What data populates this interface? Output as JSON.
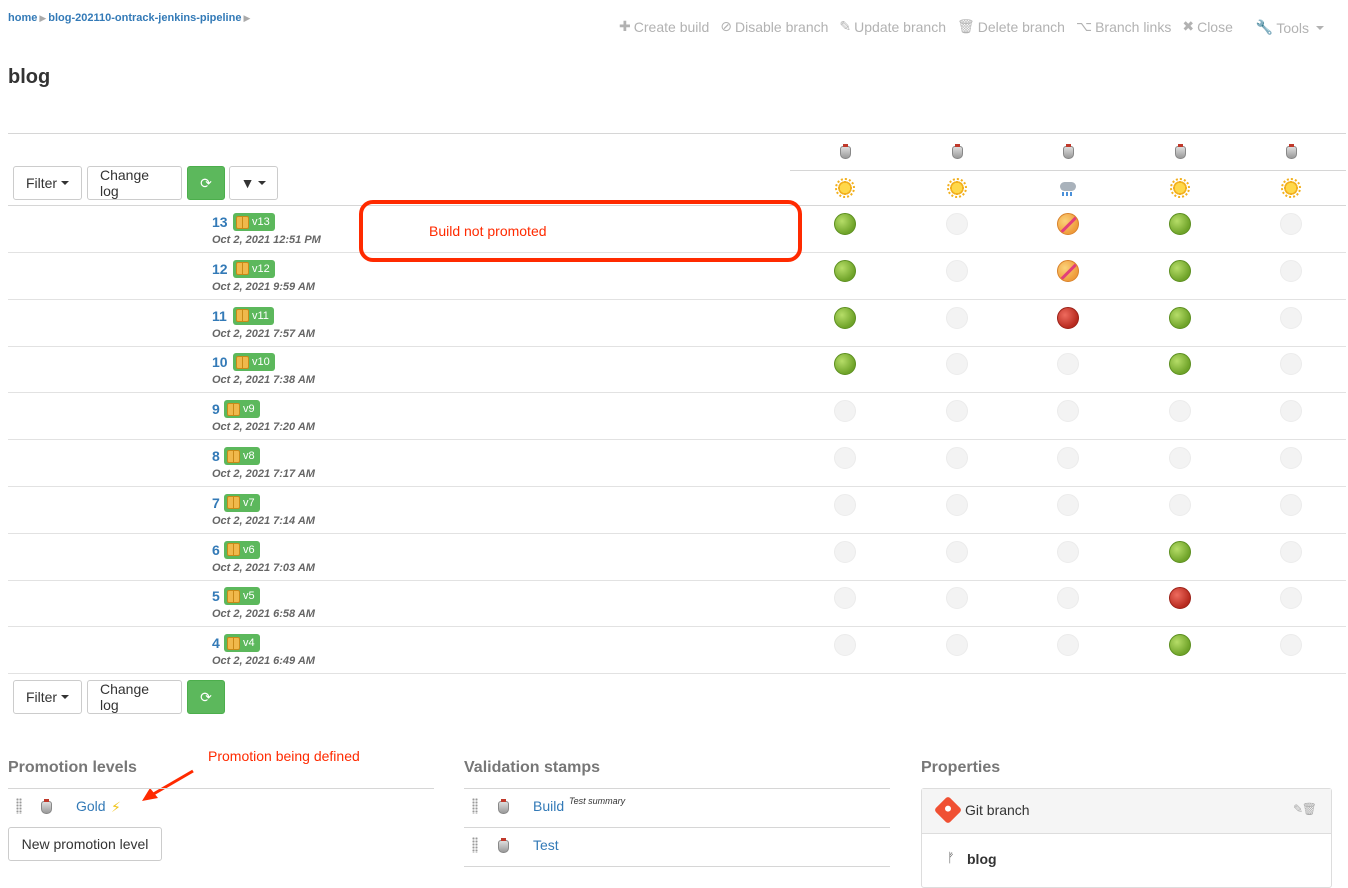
{
  "breadcrumb": {
    "home": "home",
    "project": "blog-202110-ontrack-jenkins-pipeline",
    "sep": "▶"
  },
  "toolbar": {
    "create_build": "Create build",
    "disable_branch": "Disable branch",
    "update_branch": "Update branch",
    "delete_branch": "Delete branch",
    "branch_links": "Branch links",
    "close": "Close",
    "tools": "Tools"
  },
  "page_title": "blog",
  "controls": {
    "filter": "Filter",
    "change_log": "Change log"
  },
  "column_weather": [
    "sun",
    "sun",
    "cloud-rain",
    "sun",
    "sun"
  ],
  "builds": [
    {
      "number": "13",
      "label": "v13",
      "date": "Oct 2, 2021 12:51 PM",
      "statuses": [
        "passed",
        "none",
        "defect",
        "passed",
        "none"
      ]
    },
    {
      "number": "12",
      "label": "v12",
      "date": "Oct 2, 2021 9:59 AM",
      "statuses": [
        "passed",
        "none",
        "defect",
        "passed",
        "none"
      ]
    },
    {
      "number": "11",
      "label": "v11",
      "date": "Oct 2, 2021 7:57 AM",
      "statuses": [
        "passed",
        "none",
        "failed",
        "passed",
        "none"
      ]
    },
    {
      "number": "10",
      "label": "v10",
      "date": "Oct 2, 2021 7:38 AM",
      "statuses": [
        "passed",
        "none",
        "none",
        "passed",
        "none"
      ]
    },
    {
      "number": "9",
      "label": "v9",
      "date": "Oct 2, 2021 7:20 AM",
      "statuses": [
        "none",
        "none",
        "none",
        "none",
        "none"
      ]
    },
    {
      "number": "8",
      "label": "v8",
      "date": "Oct 2, 2021 7:17 AM",
      "statuses": [
        "none",
        "none",
        "none",
        "none",
        "none"
      ]
    },
    {
      "number": "7",
      "label": "v7",
      "date": "Oct 2, 2021 7:14 AM",
      "statuses": [
        "none",
        "none",
        "none",
        "none",
        "none"
      ]
    },
    {
      "number": "6",
      "label": "v6",
      "date": "Oct 2, 2021 7:03 AM",
      "statuses": [
        "none",
        "none",
        "none",
        "passed",
        "none"
      ]
    },
    {
      "number": "5",
      "label": "v5",
      "date": "Oct 2, 2021 6:58 AM",
      "statuses": [
        "none",
        "none",
        "none",
        "failed",
        "none"
      ]
    },
    {
      "number": "4",
      "label": "v4",
      "date": "Oct 2, 2021 6:49 AM",
      "statuses": [
        "none",
        "none",
        "none",
        "passed",
        "none"
      ]
    }
  ],
  "annotations": {
    "build_not_promoted": "Build not promoted",
    "promotion_being_defined": "Promotion being defined"
  },
  "promotion_levels": {
    "title": "Promotion levels",
    "items": [
      {
        "name": "Gold"
      }
    ],
    "new_button": "New promotion level"
  },
  "validation_stamps": {
    "title": "Validation stamps",
    "items": [
      {
        "name": "Build",
        "summary": "Test summary"
      },
      {
        "name": "Test",
        "summary": ""
      }
    ]
  },
  "properties": {
    "title": "Properties",
    "git_branch": {
      "title": "Git branch",
      "value": "blog"
    }
  },
  "colors": {
    "link": "#337ab7",
    "success": "#5cb85c",
    "annotation": "#ff2a00"
  }
}
